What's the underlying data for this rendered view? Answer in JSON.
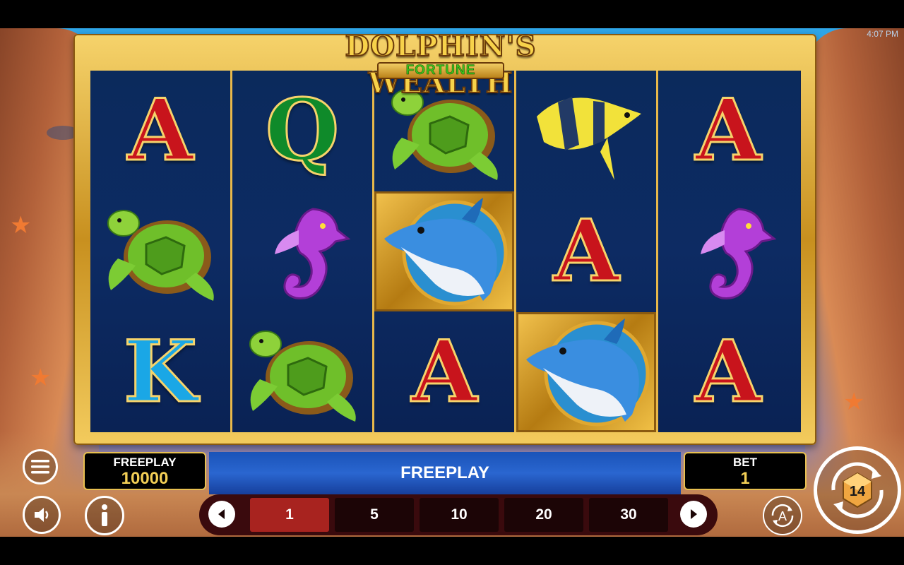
{
  "status_bar": {
    "time": "4:07 PM"
  },
  "logo": {
    "title": "DOLPHIN'S WEALTH",
    "subtitle": "FORTUNE"
  },
  "reels": [
    [
      {
        "symbol": "A",
        "kind": "letter",
        "color": "red"
      },
      {
        "symbol": "turtle",
        "kind": "icon"
      },
      {
        "symbol": "K",
        "kind": "letter",
        "color": "blue"
      }
    ],
    [
      {
        "symbol": "Q",
        "kind": "letter",
        "color": "green"
      },
      {
        "symbol": "seahorse",
        "kind": "icon"
      },
      {
        "symbol": "turtle",
        "kind": "icon"
      }
    ],
    [
      {
        "symbol": "turtle",
        "kind": "icon"
      },
      {
        "symbol": "dolphin",
        "kind": "icon",
        "highlight": true
      },
      {
        "symbol": "A",
        "kind": "letter",
        "color": "red"
      }
    ],
    [
      {
        "symbol": "angelfish",
        "kind": "icon"
      },
      {
        "symbol": "A",
        "kind": "letter",
        "color": "red"
      },
      {
        "symbol": "dolphin",
        "kind": "icon",
        "highlight": true
      }
    ],
    [
      {
        "symbol": "A",
        "kind": "letter",
        "color": "red"
      },
      {
        "symbol": "seahorse",
        "kind": "icon"
      },
      {
        "symbol": "A",
        "kind": "letter",
        "color": "red"
      }
    ]
  ],
  "balance": {
    "label": "FREEPLAY",
    "value": "10000"
  },
  "banner": {
    "text": "FREEPLAY"
  },
  "bet": {
    "label": "BET",
    "value": "1"
  },
  "bet_options": [
    "1",
    "5",
    "10",
    "20",
    "30"
  ],
  "selected_bet_index": 0,
  "autoplay": {
    "label": "A"
  },
  "spin": {
    "count": "14"
  },
  "colors": {
    "gold": "#e8b84a",
    "reel_bg": "#0c2350",
    "active_bet": "#a8231f"
  }
}
